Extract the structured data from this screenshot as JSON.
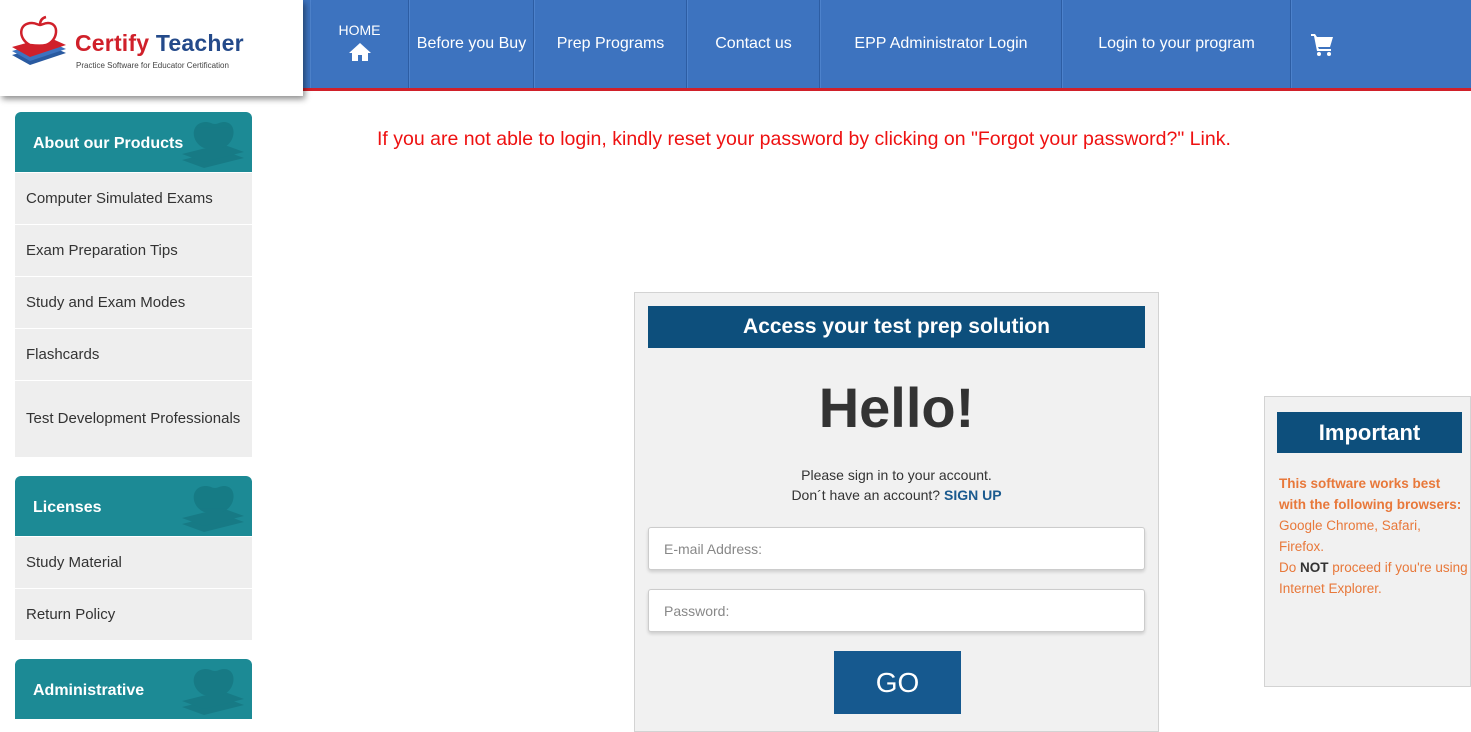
{
  "brand": {
    "name_part1": "Certify ",
    "name_part2": "Teacher",
    "tagline": "Practice Software for Educator Certification"
  },
  "nav": {
    "home_label": "HOME",
    "items": [
      "Before you Buy",
      "Prep Programs",
      "Contact us",
      "EPP Administrator Login",
      "Login to your program"
    ],
    "cart_icon": "cart-icon"
  },
  "sidebar": {
    "sections": [
      {
        "title": "About our Products",
        "items": [
          "Computer Simulated Exams",
          "Exam Preparation Tips",
          "Study and Exam Modes",
          "Flashcards",
          "Test Development Professionals"
        ]
      },
      {
        "title": "Licenses",
        "items": [
          "Study Material",
          "Return Policy"
        ]
      },
      {
        "title": "Administrative",
        "items": []
      }
    ]
  },
  "notice": "If you are not able to login, kindly reset your password by clicking on \"Forgot your password?\" Link.",
  "login": {
    "heading": "Access your test prep solution",
    "greeting": "Hello!",
    "signin_prompt": "Please sign in to your account.",
    "signup_prompt": "Don´t have an account?",
    "signup_link": "SIGN UP",
    "email_placeholder": "E-mail Address:",
    "password_placeholder": "Password:",
    "submit_label": "GO"
  },
  "important": {
    "heading": "Important",
    "lead": "This software works best with the following browsers:",
    "browsers": "Google Chrome, Safari, Firefox.",
    "warning_pre": "Do ",
    "warning_strong": "NOT",
    "warning_post": " proceed if you're using Internet Explorer."
  },
  "colors": {
    "nav_blue": "#3d73bf",
    "accent_red": "#d0202a",
    "sidebar_teal": "#1c8a95",
    "panel_navy": "#0d4f7c",
    "button_blue": "#16598f",
    "notice_red": "#ee1111",
    "important_orange": "#e8783a"
  }
}
